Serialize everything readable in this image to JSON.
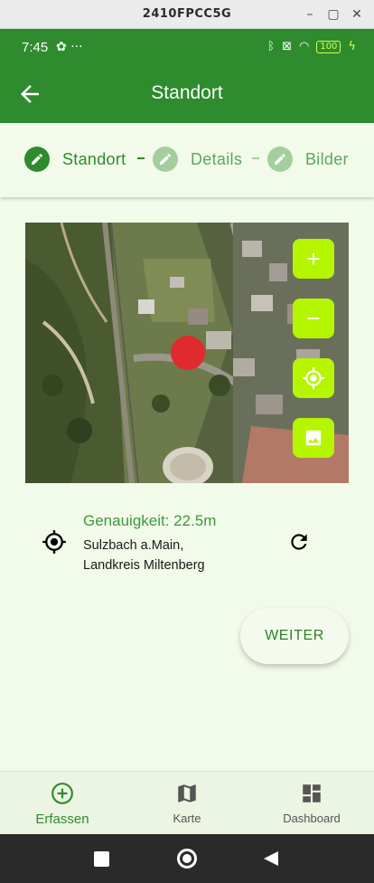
{
  "window": {
    "title": "2410FPCC5G"
  },
  "status": {
    "time": "7:45",
    "battery": "100"
  },
  "appbar": {
    "title": "Standort"
  },
  "stepper": {
    "steps": [
      {
        "label": "Standort",
        "state": "active"
      },
      {
        "label": "Details",
        "state": "inactive"
      },
      {
        "label": "Bilder",
        "state": "inactive"
      }
    ]
  },
  "map": {
    "controls": [
      "zoom-in-icon",
      "zoom-out-icon",
      "my-location-icon",
      "layers-image-icon"
    ],
    "marker_color": "#e02a2f"
  },
  "location": {
    "accuracy": "Genauigkeit: 22.5m",
    "address_line1": "Sulzbach a.Main,",
    "address_line2": "Landkreis Miltenberg"
  },
  "actions": {
    "next_label": "WEITER"
  },
  "bottom_nav": {
    "items": [
      {
        "label": "Erfassen",
        "icon": "add-circle-icon",
        "active": true
      },
      {
        "label": "Karte",
        "icon": "map-icon",
        "active": false
      },
      {
        "label": "Dashboard",
        "icon": "dashboard-icon",
        "active": false
      }
    ]
  },
  "colors": {
    "primary": "#2e8b2e",
    "accent": "#b5f500",
    "background": "#f2faea"
  }
}
